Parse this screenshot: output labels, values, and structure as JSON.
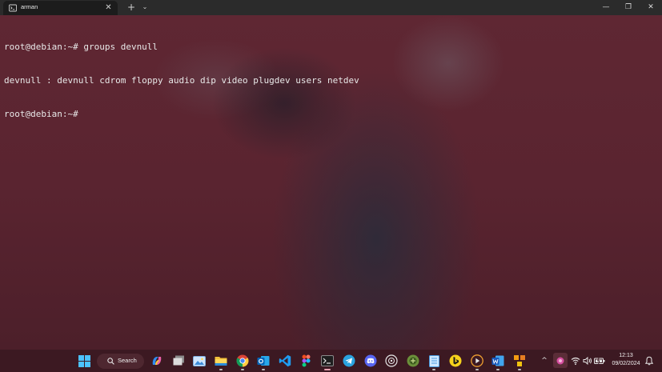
{
  "window": {
    "tab_title": "arman",
    "new_tab_symbol": "+",
    "dropdown_symbol": "⌄",
    "tab_close_symbol": "✕",
    "controls": {
      "minimize": "—",
      "maximize": "❐",
      "close": "✕"
    }
  },
  "terminal": {
    "lines": [
      "root@debian:~# groups devnull",
      "devnull : devnull cdrom floppy audio dip video plugdev users netdev",
      "root@debian:~#"
    ],
    "text_color": "#e8e8e8",
    "background_color": "#5a2430"
  },
  "taskbar": {
    "search_label": "Search",
    "apps": [
      "windows-start-icon",
      "copilot-icon",
      "task-view-icon",
      "photos-icon",
      "file-explorer-icon",
      "chrome-icon",
      "outlook-icon",
      "vscode-icon",
      "figma-icon",
      "terminal-icon",
      "telegram-icon",
      "discord-icon",
      "github-desktop-icon",
      "utility-icon",
      "notepad-icon",
      "bing-icon",
      "media-player-icon",
      "word-icon",
      "app-icon"
    ],
    "tray_chevron": "^",
    "clock_time": "12:13",
    "clock_date": "09/02/2024",
    "accent": "#3c1922"
  }
}
